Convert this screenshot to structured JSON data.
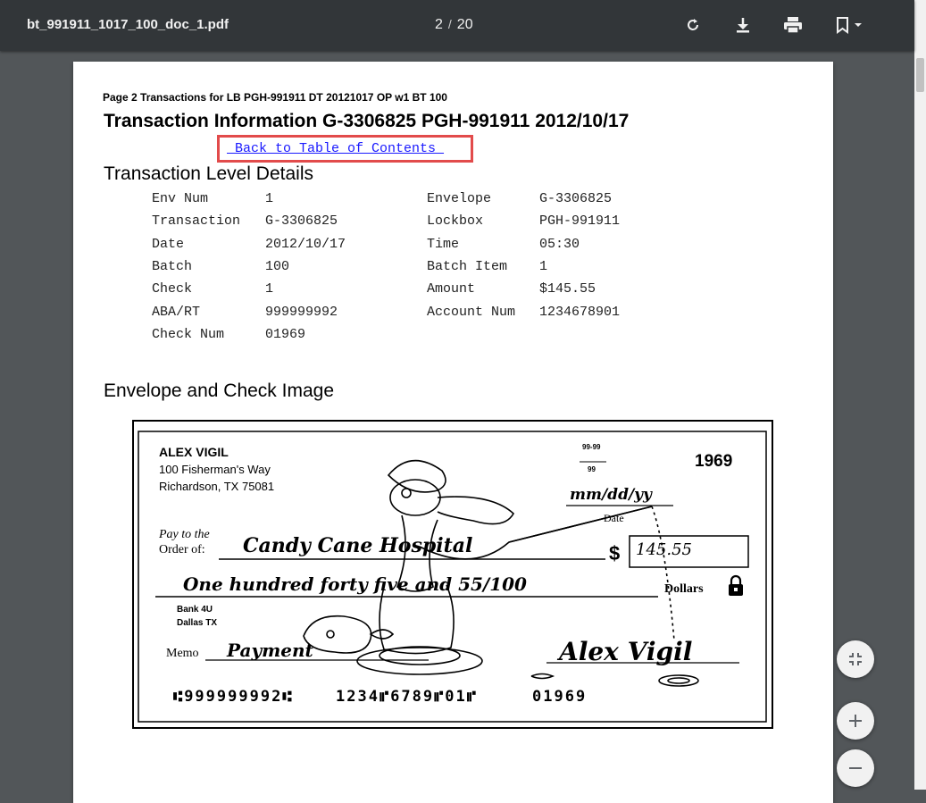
{
  "toolbar": {
    "file_name": "bt_991911_1017_100_doc_1.pdf",
    "current_page": "2",
    "page_separator": "/",
    "total_pages": "20"
  },
  "document": {
    "header_small": "Page 2 Transactions for LB PGH-991911 DT 20121017 OP w1 BT 100",
    "header_title": "Transaction Information G-3306825 PGH-991911 2012/10/17",
    "back_link": " Back to Table of Contents ",
    "section_details": "Transaction Level Details",
    "details": [
      {
        "label": "Env Num",
        "value": "1",
        "label2": "Envelope",
        "value2": "G-3306825"
      },
      {
        "label": "Transaction",
        "value": "G-3306825",
        "label2": "Lockbox",
        "value2": "PGH-991911"
      },
      {
        "label": "Date",
        "value": "2012/10/17",
        "label2": "Time",
        "value2": "05:30"
      },
      {
        "label": "Batch",
        "value": "100",
        "label2": "Batch Item",
        "value2": "1"
      },
      {
        "label": "Check",
        "value": "1",
        "label2": "Amount",
        "value2": "$145.55"
      },
      {
        "label": "ABA/RT",
        "value": "999999992",
        "label2": "Account Num",
        "value2": "1234678901"
      },
      {
        "label": "Check Num",
        "value": "01969",
        "label2": "",
        "value2": ""
      }
    ],
    "section_image": "Envelope and Check Image"
  },
  "check": {
    "payer_name": "ALEX VIGIL",
    "payer_address1": "100 Fisherman's Way",
    "payer_address2": "Richardson, TX 75081",
    "routing_fraction_top": "99-99",
    "routing_fraction_bottom": "99",
    "check_number": "1969",
    "date_value": "mm/dd/yy",
    "date_label": "Date",
    "pay_to_label1": "Pay to the",
    "pay_to_label2": "Order of:",
    "payee": "Candy Cane Hospital",
    "dollar_sign": "$",
    "amount_box": "145.55",
    "amount_words": "One hundred forty five and 55/100",
    "dollars_label": "Dollars",
    "bank_name": "Bank 4U",
    "bank_city": "Dallas TX",
    "memo_label": "Memo",
    "memo_value": "Payment",
    "signature": "Alex Vigil",
    "micr_routing": "⑆999999992⑆",
    "micr_account": "1234⑈6789⑈01⑈",
    "micr_check": "01969"
  }
}
